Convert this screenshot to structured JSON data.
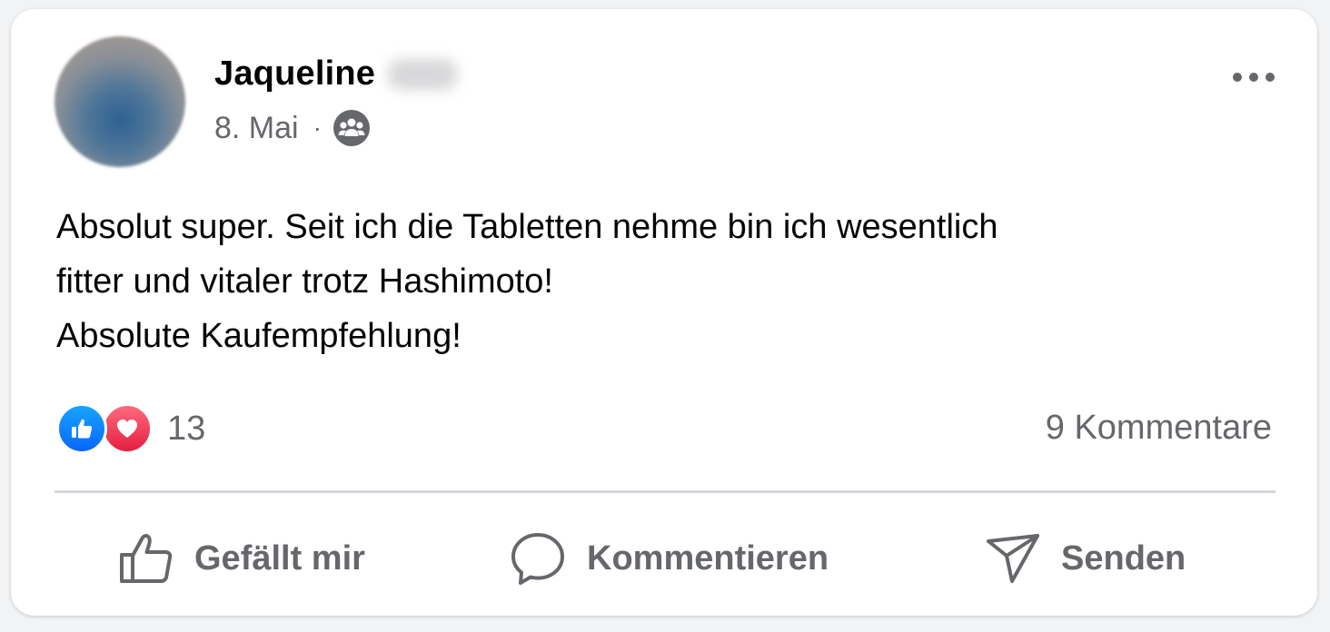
{
  "post": {
    "author": "Jaqueline",
    "date": "8. Mai",
    "separator": "·",
    "audience_icon": "friends-icon",
    "text_lines": [
      "Absolut super. Seit ich die Tabletten nehme bin ich wesentlich",
      "fitter und vitaler trotz Hashimoto!",
      "Absolute Kaufempfehlung!"
    ]
  },
  "reactions": {
    "types": [
      "like",
      "love"
    ],
    "count": "13",
    "like_color": "#0866ff",
    "love_color": "#e41e3f"
  },
  "comments": {
    "label": "9 Kommentare"
  },
  "actions": {
    "like_label": "Gefällt mir",
    "comment_label": "Kommentieren",
    "share_label": "Senden"
  },
  "colors": {
    "text_primary": "#050505",
    "text_secondary": "#65676b",
    "divider": "#d4d6da"
  }
}
